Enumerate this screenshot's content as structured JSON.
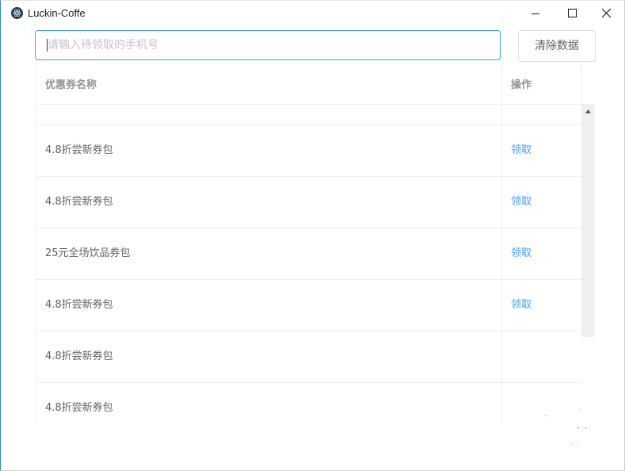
{
  "window": {
    "title": "Luckin-Coffe",
    "icon": "electron-atom-icon",
    "controls": [
      "minimize-icon",
      "maximize-icon",
      "close-icon"
    ]
  },
  "search": {
    "value": "",
    "placeholder": "请输入待领取的手机号"
  },
  "toolbar": {
    "clear_label": "清除数据"
  },
  "table": {
    "headers": {
      "name": "优惠券名称",
      "action": "操作"
    },
    "rows": [
      {
        "name": "4.8折尝新券包",
        "action": "领取"
      },
      {
        "name": "4.8折尝新券包",
        "action": "领取"
      },
      {
        "name": "25元全场饮品券包",
        "action": "领取"
      },
      {
        "name": "4.8折尝新券包",
        "action": "领取"
      },
      {
        "name": "4.8折尝新券包",
        "action": ""
      },
      {
        "name": "4.8折尝新券包",
        "action": ""
      }
    ]
  },
  "colors": {
    "accent": "#409eff",
    "text": "#606266",
    "header_text": "#909399",
    "border": "#ebeef5"
  }
}
